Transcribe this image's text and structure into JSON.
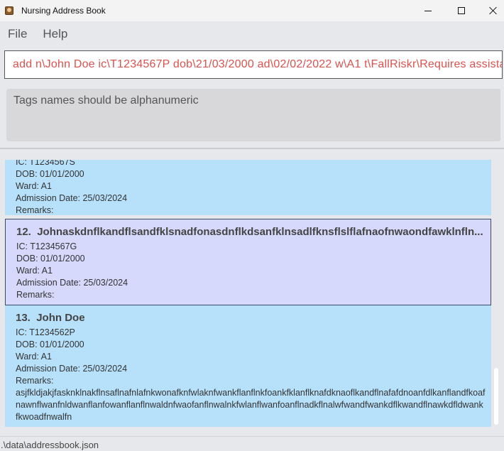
{
  "window": {
    "title": "Nursing Address Book"
  },
  "menu": {
    "items": [
      "File",
      "Help"
    ]
  },
  "command": {
    "value": "add n\\John Doe ic\\T1234567P dob\\21/03/2000 ad\\02/02/2022 w\\A1 t\\FallRiskr\\Requires assista"
  },
  "result": {
    "message": "Tags names should be alphanumeric"
  },
  "patients": [
    {
      "index": "",
      "name": "",
      "ic": "IC: T1234567S",
      "dob": "DOB: 01/01/2000",
      "ward": "Ward: A1",
      "admission": "Admission Date: 25/03/2024",
      "remarks_label": "Remarks:",
      "remarks": ""
    },
    {
      "index": "12.",
      "name": "Johnaskdnflkandflsandfklsnadfonasdnflkdsanfklnsadlfknsflslflafnaofnwaondfawklnfln...",
      "ic": "IC: T1234567G",
      "dob": "DOB: 01/01/2000",
      "ward": "Ward: A1",
      "admission": "Admission Date: 25/03/2024",
      "remarks_label": "Remarks:",
      "remarks": ""
    },
    {
      "index": "13.",
      "name": "John Doe",
      "ic": "IC: T1234562P",
      "dob": "DOB: 01/01/2000",
      "ward": "Ward: A1",
      "admission": "Admission Date: 25/03/2024",
      "remarks_label": "Remarks:",
      "remarks": "asjfkldjakjfasknklnakflnsaflnafnlafnkwonafknfwlaknfwankflanflnkfoankfklanflknafdknaoflkandflnafafdnoanfdlkanflandfkoafnawnflwanfnldwanflanfowanflanflnwaldnfwaofanflnwalnkfwlanflwanfoanflnadkflnalwfwandfwankdflkwandflnawkdfldwankfkwoadfnwalfn"
    }
  ],
  "status": {
    "path": ".\\data\\addressbook.json"
  },
  "icons": {
    "app": "address-book-icon",
    "minimize": "minimize-icon",
    "maximize": "maximize-icon",
    "close": "close-icon"
  }
}
